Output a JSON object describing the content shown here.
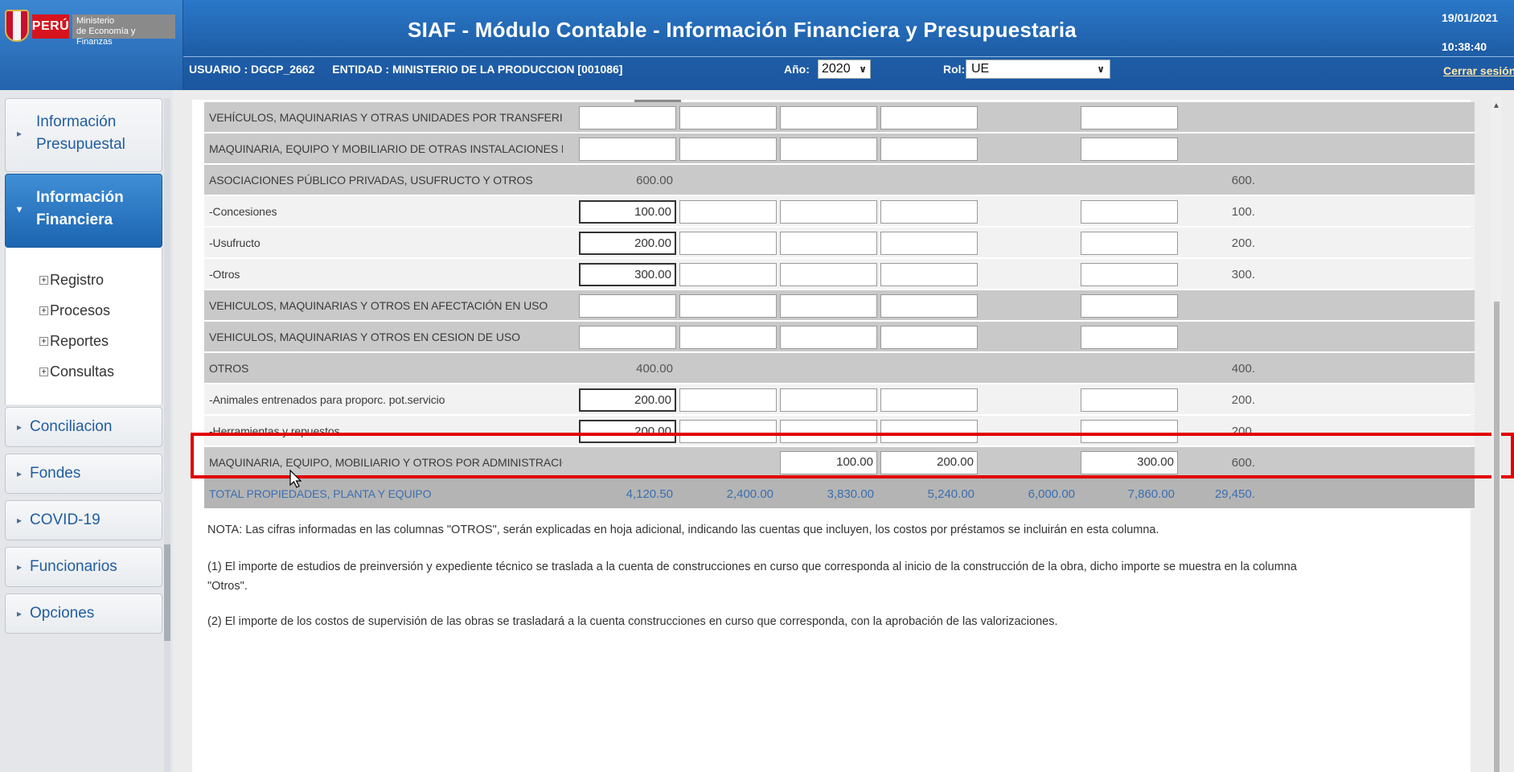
{
  "header": {
    "country": "PERÚ",
    "ministry_line1": "Ministerio",
    "ministry_line2": "de Economía y Finanzas",
    "title": "SIAF - Módulo Contable - Información Financiera y Presupuestaria",
    "user": "USUARIO : DGCP_2662",
    "entity": "ENTIDAD : MINISTERIO DE LA PRODUCCION  [001086]",
    "year_label": "Año:",
    "year_value": "2020",
    "rol_label": "Rol:",
    "rol_value": "UE",
    "date": "19/01/2021",
    "time": "10:38:40",
    "logout": "Cerrar sesión"
  },
  "sidebar": {
    "items": [
      {
        "label_line1": "Información",
        "label_line2": "Presupuestal"
      },
      {
        "label_line1": "Información",
        "label_line2": "Financiera"
      }
    ],
    "submenu": [
      "Registro",
      "Procesos",
      "Reportes",
      "Consultas"
    ],
    "bottom_items": [
      "Conciliacion",
      "Fondes",
      "COVID-19",
      "Funcionarios",
      "Opciones"
    ]
  },
  "table": {
    "rows": [
      {
        "label": "VEHÍCULOS, MAQUINARIAS Y OTRAS UNIDADES POR TRANSFERIR",
        "c1": "",
        "c2": "",
        "c3": "",
        "c4": "",
        "c5": "",
        "c6": "",
        "c7": ""
      },
      {
        "label": "MAQUINARIA, EQUIPO Y MOBILIARIO DE OTRAS INSTALACIONES POR REC",
        "c1": "",
        "c2": "",
        "c3": "",
        "c4": "",
        "c5": "",
        "c6": "",
        "c7": ""
      },
      {
        "label": "ASOCIACIONES PÚBLICO PRIVADAS, USUFRUCTO Y OTROS",
        "c1": "600.00",
        "c2": "",
        "c3": "",
        "c4": "",
        "c5": "",
        "c6": "",
        "c7": "600."
      },
      {
        "label": "-Concesiones",
        "c1": "100.00",
        "c2": "",
        "c3": "",
        "c4": "",
        "c5": "",
        "c6": "",
        "c7": "100."
      },
      {
        "label": "-Usufructo",
        "c1": "200.00",
        "c2": "",
        "c3": "",
        "c4": "",
        "c5": "",
        "c6": "",
        "c7": "200."
      },
      {
        "label": "-Otros",
        "c1": "300.00",
        "c2": "",
        "c3": "",
        "c4": "",
        "c5": "",
        "c6": "",
        "c7": "300."
      },
      {
        "label": "VEHICULOS, MAQUINARIAS Y OTROS EN AFECTACIÓN EN USO",
        "c1": "",
        "c2": "",
        "c3": "",
        "c4": "",
        "c5": "",
        "c6": "",
        "c7": ""
      },
      {
        "label": "VEHICULOS, MAQUINARIAS Y OTROS EN CESION DE USO",
        "c1": "",
        "c2": "",
        "c3": "",
        "c4": "",
        "c5": "",
        "c6": "",
        "c7": ""
      },
      {
        "label": "OTROS",
        "c1": "400.00",
        "c2": "",
        "c3": "",
        "c4": "",
        "c5": "",
        "c6": "",
        "c7": "400."
      },
      {
        "label": "-Animales entrenados para proporc. pot.servicio",
        "c1": "200.00",
        "c2": "",
        "c3": "",
        "c4": "",
        "c5": "",
        "c6": "",
        "c7": "200."
      },
      {
        "label": "-Herramientas y repuestos",
        "c1": "200.00",
        "c2": "",
        "c3": "",
        "c4": "",
        "c5": "",
        "c6": "",
        "c7": "200."
      },
      {
        "label": "MAQUINARIA, EQUIPO, MOBILIARIO Y OTROS POR ADMINISTRACIÓN FUN",
        "c1": "",
        "c2": "",
        "c3": "100.00",
        "c4": "200.00",
        "c5": "",
        "c6": "300.00",
        "c7": "600."
      },
      {
        "label": "TOTAL PROPIEDADES, PLANTA Y EQUIPO",
        "c1": "4,120.50",
        "c2": "2,400.00",
        "c3": "3,830.00",
        "c4": "5,240.00",
        "c5": "6,000.00",
        "c6": "7,860.00",
        "c7": "29,450."
      }
    ]
  },
  "notes": {
    "n0": "NOTA: Las cifras informadas en las columnas \"OTROS\", serán explicadas en hoja adicional, indicando las cuentas que incluyen, los costos por préstamos se incluirán en esta columna.",
    "n1a": "(1) El importe de estudios de preinversión y expediente técnico se traslada a la cuenta de construcciones en curso que corresponda al inicio de la construcción de la obra, dicho importe se muestra en la columna",
    "n1b": "\"Otros\".",
    "n2": "(2) El importe de los costos de supervisión de las obras se trasladará a la cuenta construcciones en curso que corresponda, con la aprobación de las valorizaciones."
  },
  "colors": {
    "header_blue": "#1f5fa8",
    "active_nav": "#1c64b0",
    "highlight_red": "#e10000",
    "peru_red": "#d7141e"
  }
}
